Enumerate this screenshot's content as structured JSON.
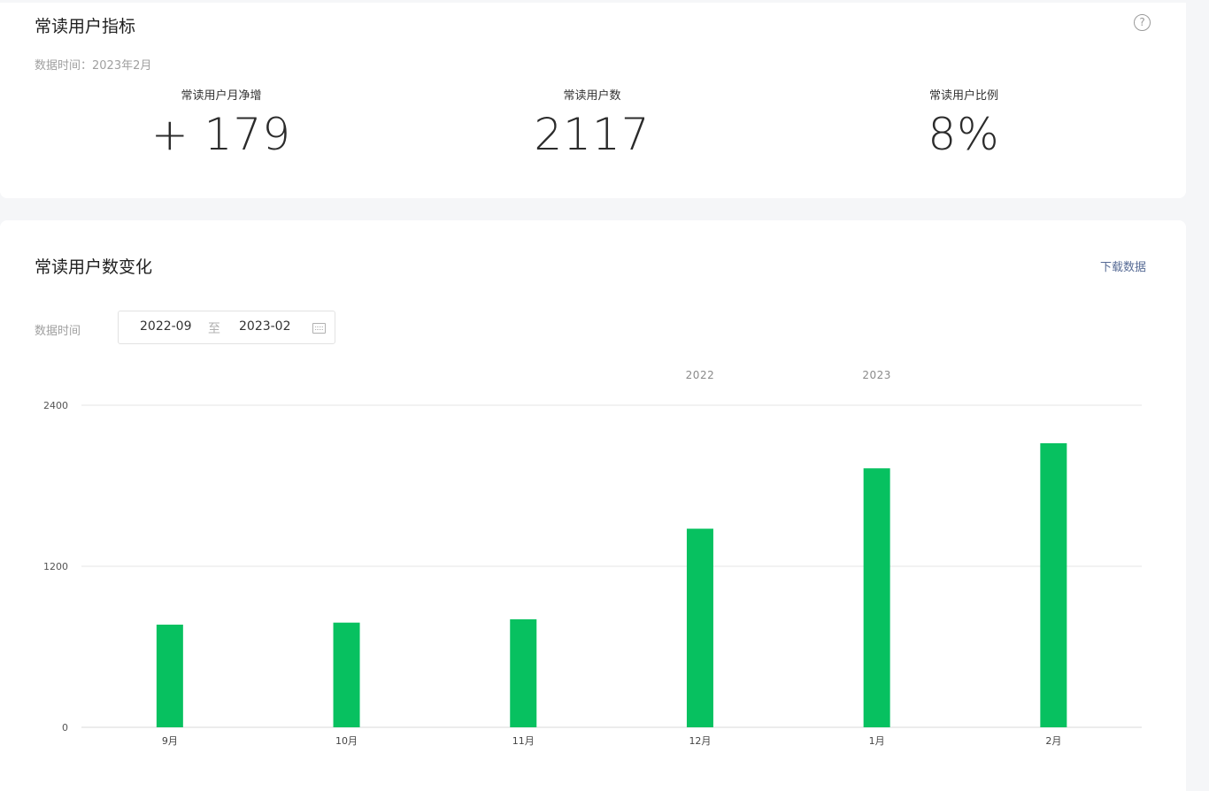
{
  "metrics_card": {
    "title": "常读用户指标",
    "data_time": "数据时间：2023年2月",
    "help_icon": "question-circle-icon",
    "metrics": [
      {
        "label": "常读用户月净增",
        "value": "+ 179"
      },
      {
        "label": "常读用户数",
        "value": "2117"
      },
      {
        "label": "常读用户比例",
        "value": "8%"
      }
    ]
  },
  "trend_card": {
    "title": "常读用户数变化",
    "download_label": "下载数据",
    "filter_label": "数据时间",
    "range": {
      "start": "2022-09",
      "separator": "至",
      "end": "2023-02",
      "icon": "calendar-icon"
    }
  },
  "colors": {
    "bar": "#07c160",
    "link": "#576b95",
    "grid": "#e6e6e6"
  },
  "chart_data": {
    "type": "bar",
    "categories": [
      "9月",
      "10月",
      "11月",
      "12月",
      "1月",
      "2月"
    ],
    "year_labels": [
      {
        "label": "2022",
        "at_category": 3
      },
      {
        "label": "2023",
        "at_category": 4
      }
    ],
    "values": [
      765,
      780,
      805,
      1480,
      1930,
      2117
    ],
    "ylim": [
      0,
      2400
    ],
    "yticks": [
      0,
      1200,
      2400
    ],
    "grid": true
  }
}
